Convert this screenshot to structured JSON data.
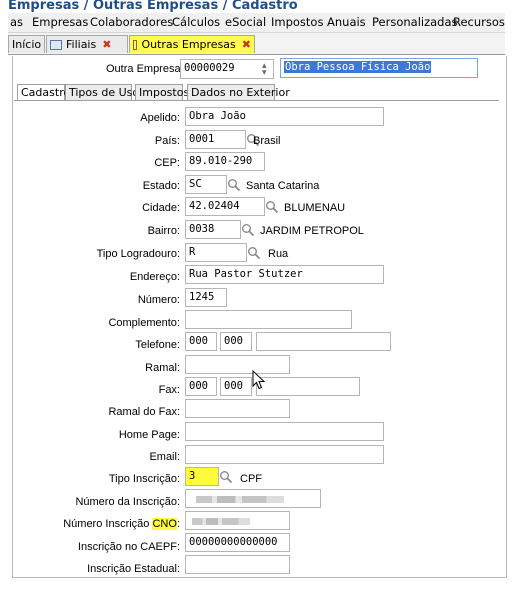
{
  "breadcrumb": "Empresas / Outras Empresas / Cadastro",
  "menu": [
    "as",
    "Empresas",
    "Colaboradores",
    "Cálculos",
    "eSocial",
    "Impostos",
    "Anuais",
    "Personalizadas",
    "Recursos"
  ],
  "window_tabs": [
    {
      "label": "Início"
    },
    {
      "label": "Filiais"
    },
    {
      "label": "Outras Empresas"
    }
  ],
  "header": {
    "outra_empresa_label": "Outra Empresa:",
    "outra_empresa_code": "00000029",
    "outra_empresa_name": "Obra Pessoa Física João"
  },
  "inner_tabs": [
    "Cadastro",
    "Tipos de Uso",
    "Impostos",
    "Dados no Exterior"
  ],
  "form": {
    "apelido": {
      "label": "Apelido:",
      "value": "Obra João"
    },
    "pais": {
      "label": "País:",
      "code": "0001",
      "desc": "Brasil"
    },
    "cep": {
      "label": "CEP:",
      "value": "89.010-290"
    },
    "estado": {
      "label": "Estado:",
      "code": "SC",
      "desc": "Santa Catarina"
    },
    "cidade": {
      "label": "Cidade:",
      "code": "42.02404",
      "desc": "BLUMENAU"
    },
    "bairro": {
      "label": "Bairro:",
      "code": "0038",
      "desc": "JARDIM PETROPOL"
    },
    "tipo_logradouro": {
      "label": "Tipo Logradouro:",
      "code": "R",
      "desc": "Rua"
    },
    "endereco": {
      "label": "Endereço:",
      "value": "Rua Pastor Stutzer"
    },
    "numero": {
      "label": "Número:",
      "value": "1245"
    },
    "complemento": {
      "label": "Complemento:",
      "value": ""
    },
    "telefone": {
      "label": "Telefone:",
      "ddd": "000",
      "prefixo": "000",
      "numero": ""
    },
    "ramal": {
      "label": "Ramal:",
      "value": ""
    },
    "fax": {
      "label": "Fax:",
      "ddd": "000",
      "prefixo": "000",
      "numero": ""
    },
    "ramal_fax": {
      "label": "Ramal do Fax:",
      "value": ""
    },
    "home_page": {
      "label": "Home Page:",
      "value": ""
    },
    "email": {
      "label": "Email:",
      "value": ""
    },
    "tipo_inscricao": {
      "label": "Tipo Inscrição:",
      "code": "3",
      "desc": "CPF"
    },
    "numero_inscricao": {
      "label": "Número da Inscrição:",
      "value": ""
    },
    "numero_inscricao_cno": {
      "label_prefix": "Número Inscrição ",
      "label_hl": "CNO",
      "label_suffix": ":",
      "value": ""
    },
    "inscricao_caepf": {
      "label": "Inscrição no CAEPF:",
      "value": "00000000000000"
    },
    "inscricao_estadual": {
      "label": "Inscrição Estadual:",
      "value": ""
    }
  },
  "colors": {
    "highlight": "#fffb3b",
    "breadcrumb": "#1f4e8c",
    "selection": "#3b78d8",
    "close_x": "#c8361b"
  }
}
